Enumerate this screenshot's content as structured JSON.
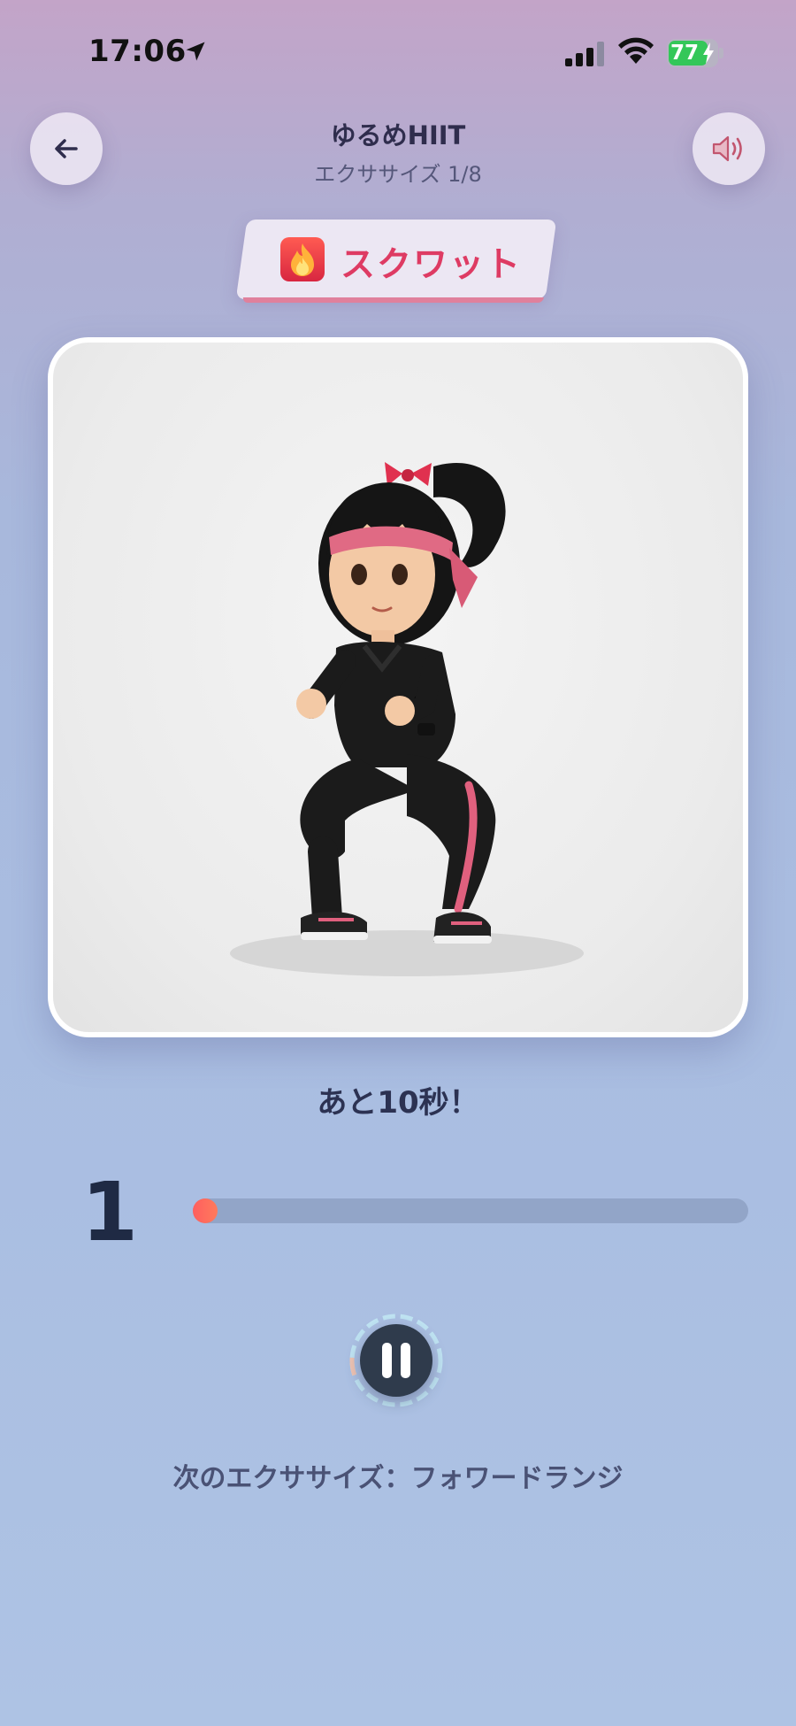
{
  "status_bar": {
    "time": "17:06",
    "battery": "77"
  },
  "header": {
    "title": "ゆるめHIIT",
    "subtitle": "エクササイズ 1/8",
    "back_icon": "arrow-left-icon",
    "sound_icon": "speaker-icon"
  },
  "exercise": {
    "name": "スクワット",
    "icon": "fire-icon",
    "image_description_icon": "squat-illustration"
  },
  "timer": {
    "remaining_text": "あと10秒！",
    "count": "1",
    "progress": 0.02
  },
  "controls": {
    "pause_icon": "pause-icon"
  },
  "next": {
    "text": "次のエクササイズ：フォワードランジ"
  },
  "colors": {
    "accent": "#de3b63",
    "progress": "#ff6a5c",
    "battery": "#34c759"
  }
}
